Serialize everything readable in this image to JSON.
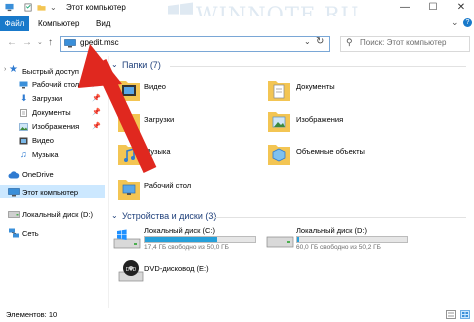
{
  "window": {
    "title": "Этот компьютер",
    "watermark": "WINNOTE.RU",
    "minimize": "—",
    "maximize": "☐",
    "close": "✕"
  },
  "ribbon": {
    "tabs": [
      "Файл",
      "Компьютер",
      "Вид"
    ],
    "collapse": "⌄",
    "help": "?"
  },
  "navigation": {
    "back": "←",
    "forward": "→",
    "up": "↑",
    "address_value": "gpedit.msc",
    "search_placeholder": "Поиск: Этот компьютер"
  },
  "sidebar": {
    "items": [
      {
        "label": "Быстрый доступ",
        "icon": "star-icon"
      },
      {
        "label": "Рабочий стол",
        "icon": "desktop-icon"
      },
      {
        "label": "Загрузки",
        "icon": "download-icon"
      },
      {
        "label": "Документы",
        "icon": "documents-icon"
      },
      {
        "label": "Изображения",
        "icon": "pictures-icon"
      },
      {
        "label": "Видео",
        "icon": "video-icon"
      },
      {
        "label": "Музыка",
        "icon": "music-icon"
      },
      {
        "label": "OneDrive",
        "icon": "cloud-icon"
      },
      {
        "label": "Этот компьютер",
        "icon": "computer-icon"
      },
      {
        "label": "Локальный диск (D:)",
        "icon": "drive-icon"
      },
      {
        "label": "Сеть",
        "icon": "network-icon"
      }
    ]
  },
  "main": {
    "folders_header": "Папки (7)",
    "folders": [
      {
        "label": "Видео",
        "icon": "video-folder-icon"
      },
      {
        "label": "Документы",
        "icon": "documents-folder-icon"
      },
      {
        "label": "Загрузки",
        "icon": "downloads-folder-icon"
      },
      {
        "label": "Изображения",
        "icon": "pictures-folder-icon"
      },
      {
        "label": "Музыка",
        "icon": "music-folder-icon"
      },
      {
        "label": "Объемные объекты",
        "icon": "3d-objects-folder-icon"
      },
      {
        "label": "Рабочий стол",
        "icon": "desktop-folder-icon"
      }
    ],
    "drives_header": "Устройства и диски (3)",
    "drives": [
      {
        "label": "Локальный диск (C:)",
        "free": "17,4 ГБ свободно из 50,0 ГБ",
        "used_fraction": 0.65
      },
      {
        "label": "Локальный диск (D:)",
        "free": "60,0 ГБ свободно из 50,2 ГБ",
        "used_fraction": 0.02
      },
      {
        "label": "DVD-дисковод (E:)",
        "free": "",
        "used_fraction": null
      }
    ]
  },
  "status": {
    "items": "Элементов: 10"
  },
  "colors": {
    "accent": "#1979ca",
    "selection": "#cce8ff",
    "section_title": "#1e3f7a",
    "folder": "#f3c553",
    "bar_fill": "#26a0da",
    "arrow": "#e0281f"
  }
}
